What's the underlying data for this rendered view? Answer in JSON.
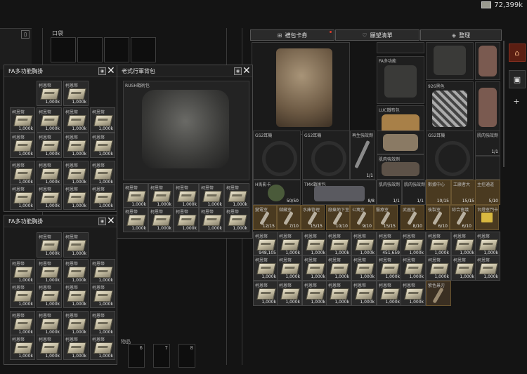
{
  "header": {
    "money": "72,399k"
  },
  "pocket": {
    "label": "口袋"
  },
  "toolbar": {
    "gift_label": "禮包卡券",
    "wishlist_label": "願望清單",
    "sort_label": "整理"
  },
  "rig1": {
    "title": "FA多功能胸掛"
  },
  "backpack": {
    "title": "老式行軍背包",
    "inner_label": "RUSH戰術包"
  },
  "rig2": {
    "title": "FA多功能胸掛"
  },
  "money_item": {
    "name": "柯恩幣",
    "count": "1,000k"
  },
  "stash": {
    "labels": {
      "fa": "FA多功能",
      "t926": "926黑色",
      "luc": "LUC鐵布包",
      "gs2a": "GS2耳機",
      "gs2b": "GS2耳機",
      "life": "再生強效劑",
      "gs2c": "GS2耳機",
      "muscle1": "肌肉強效劑",
      "muscle2": "肌肉強效劑",
      "muscle3": "肌肉強效劑",
      "muscle4": "肌肉強效劑",
      "tmk": "TMK戰術包",
      "mask": "H馬影卡",
      "key1": "數據中心",
      "key2": "工廠者大",
      "key3": "主控通道",
      "key4": "變電室",
      "key5": "儲藏室",
      "key6": "水庫管理",
      "key7": "廢棄地下室",
      "key8": "公寓室",
      "key9": "醫療室",
      "key10": "武器室",
      "key11": "後製室",
      "key12": "綜合會議",
      "key13": "台燈室門卡",
      "cash_big": "柯恩幣",
      "knife": "紫色景刃"
    },
    "counts": {
      "life": "1/1",
      "muscle1": "1/1",
      "muscle2": "1/1",
      "muscle3": "1/1",
      "muscle4": "1/1",
      "mask": "50/50",
      "tmk": "8/8",
      "key1": "10/15",
      "key2": "15/15",
      "key3": "5/10",
      "key4": "12/15",
      "key5": "7/10",
      "key6": "15/15",
      "key7": "10/10",
      "key8": "9/10",
      "key9": "15/15",
      "key10": "8/10",
      "key11": "6/10",
      "key12": "6/10",
      "cash_a": "948,105",
      "cash_b": "451,659"
    }
  },
  "lower_slots": {
    "label": "物品",
    "nums": [
      "6",
      "7",
      "8"
    ]
  },
  "side": {
    "home": "⌂",
    "box": "▣",
    "plus": "+"
  }
}
